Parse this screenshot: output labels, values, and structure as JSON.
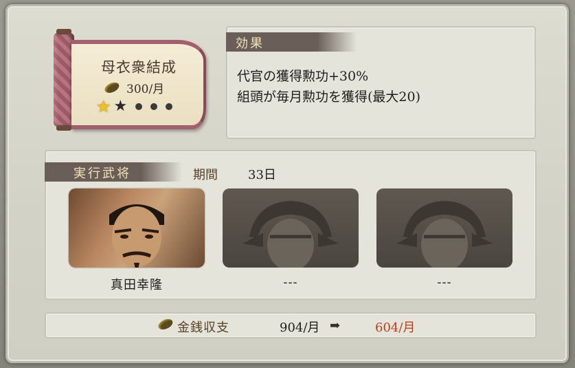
{
  "scroll": {
    "title": "母衣衆結成",
    "cost": "300/月",
    "rank_filled": 1,
    "rank_total": 5
  },
  "effect": {
    "header": "効果",
    "lines": [
      "代官の獲得勲功+30%",
      "組頭が毎月勲功を獲得(最大20)"
    ]
  },
  "execution": {
    "header": "実行武将",
    "period_label": "期間",
    "period_value": "33日",
    "officers": [
      {
        "name": "真田幸隆",
        "portrait": "officer-portrait"
      },
      {
        "name": "---",
        "portrait": "empty-slot-silhouette"
      },
      {
        "name": "---",
        "portrait": "empty-slot-silhouette"
      }
    ]
  },
  "money": {
    "label": "金銭収支",
    "current": "904/月",
    "next": "604/月",
    "next_color": "#b8401c"
  },
  "colors": {
    "header_bg": "#6a5f58",
    "header_text": "#f3e2b4",
    "panel_bg": "#d2d2c6"
  }
}
